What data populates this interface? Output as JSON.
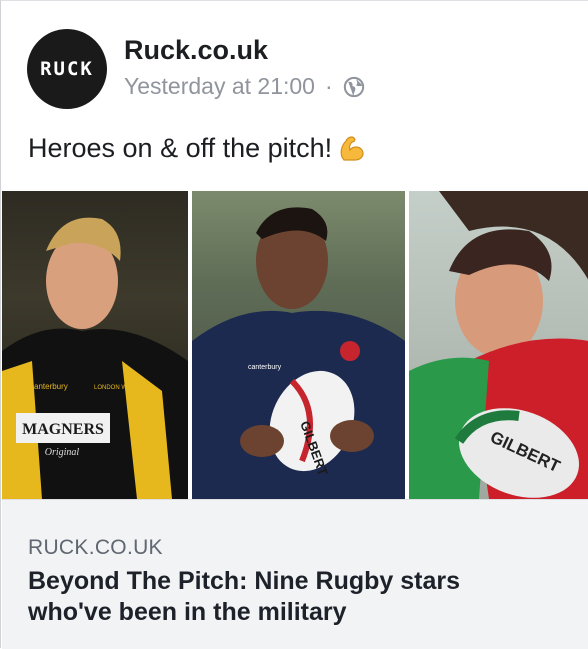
{
  "post": {
    "avatar_text": "RUCK",
    "page_name": "Ruck.co.uk",
    "timestamp": "Yesterday at 21:00",
    "separator": "·",
    "privacy_icon": "globe-icon",
    "message": "Heroes on & off the pitch!",
    "message_emoji": "flexed-biceps-emoji"
  },
  "image": {
    "panels": [
      {
        "name": "player-wasps-photo",
        "jersey_texts": [
          "canterbury",
          "LONDON WASPS",
          "MAGNERS",
          "Original"
        ]
      },
      {
        "name": "player-england-photo",
        "jersey_texts": [
          "canterbury",
          "GILBERT"
        ]
      },
      {
        "name": "player-wales-photo",
        "jersey_texts": [
          "GILBERT"
        ]
      }
    ]
  },
  "link": {
    "domain": "RUCK.CO.UK",
    "title": "Beyond The Pitch: Nine Rugby stars who've been in the military"
  },
  "colors": {
    "text_primary": "#1c1e21",
    "text_secondary": "#90949c",
    "link_bg": "#f2f3f5",
    "link_domain": "#606770",
    "avatar_bg": "#1a1a1a"
  }
}
